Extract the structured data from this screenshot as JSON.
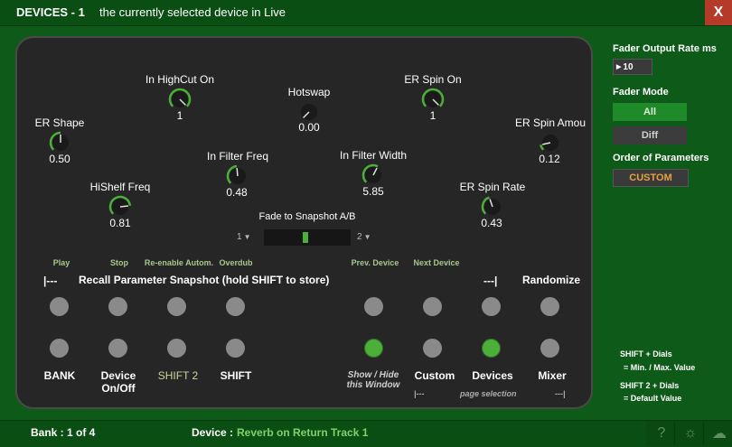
{
  "window": {
    "title": "DEVICES - 1",
    "subtitle": "the currently selected device in Live",
    "close_label": "X"
  },
  "knobs": [
    {
      "id": "er-shape",
      "label": "ER Shape",
      "value": "0.50",
      "level": 0.5
    },
    {
      "id": "in-highcut-on",
      "label": "In HighCut On",
      "value": "1",
      "level": 1.0
    },
    {
      "id": "hotswap",
      "label": "Hotswap",
      "value": "0.00",
      "level": 0.0
    },
    {
      "id": "er-spin-on",
      "label": "ER Spin On",
      "value": "1",
      "level": 1.0
    },
    {
      "id": "er-spin-amou",
      "label": "ER Spin Amou",
      "value": "0.12",
      "level": 0.12
    },
    {
      "id": "in-filter-freq",
      "label": "In Filter Freq",
      "value": "0.48",
      "level": 0.48
    },
    {
      "id": "in-filter-width",
      "label": "In Filter Width",
      "value": "5.85",
      "level": 0.6
    },
    {
      "id": "hishelf-freq",
      "label": "HiShelf Freq",
      "value": "0.81",
      "level": 0.81
    },
    {
      "id": "er-spin-rate",
      "label": "ER Spin Rate",
      "value": "0.43",
      "level": 0.43
    }
  ],
  "fade": {
    "label": "Fade to Snapshot A/B",
    "a_value": "1",
    "b_value": "2",
    "position": 0.5
  },
  "transport": {
    "play": "Play",
    "stop": "Stop",
    "reenable": "Re-enable Autom.",
    "overdub": "Overdub",
    "prev_device": "Prev. Device",
    "next_device": "Next Device"
  },
  "snapshot": {
    "left_marker": "|---",
    "label": "Recall Parameter Snapshot (hold SHIFT to store)",
    "right_marker": "---|",
    "randomize": "Randomize"
  },
  "bottom": {
    "bank": "BANK",
    "device_onoff_1": "Device",
    "device_onoff_2": "On/Off",
    "shift2": "SHIFT 2",
    "shift": "SHIFT",
    "show_hide_1": "Show / Hide",
    "show_hide_2": "this Window",
    "custom": "Custom",
    "devices": "Devices",
    "mixer": "Mixer",
    "page_left": "|---",
    "page_selection": "page selection",
    "page_right": "---|"
  },
  "sidebar": {
    "fader_rate_label": "Fader Output Rate ms",
    "fader_rate_value": "10",
    "fader_mode_label": "Fader Mode",
    "fader_mode_all": "All",
    "fader_mode_diff": "Diff",
    "order_label": "Order of Parameters",
    "order_value": "CUSTOM",
    "help1_a": "SHIFT  +  Dials",
    "help1_b": "=  Min. / Max. Value",
    "help2_a": "SHIFT 2  +  Dials",
    "help2_b": "=  Default Value"
  },
  "status": {
    "bank": "Bank : 1 of 4",
    "device_prefix": "Device :",
    "device_name": "Reverb on Return Track 1"
  },
  "colors": {
    "accent_green": "#4caf39",
    "yellow_green": "#c7d89a",
    "close_red": "#b53a2a",
    "orange": "#e8a040"
  }
}
